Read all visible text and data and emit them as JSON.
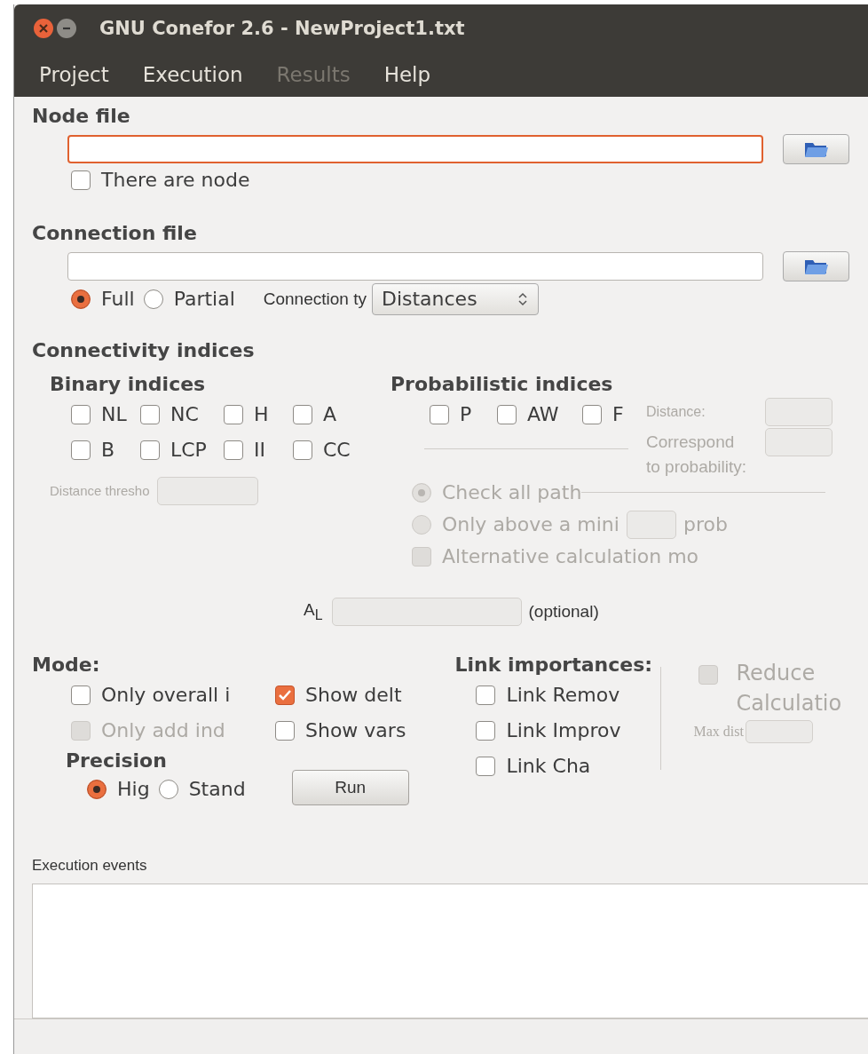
{
  "window": {
    "title": "GNU Conefor 2.6 - NewProject1.txt"
  },
  "menu": [
    {
      "label": "Project",
      "disabled": false
    },
    {
      "label": "Execution",
      "disabled": false
    },
    {
      "label": "Results",
      "disabled": true
    },
    {
      "label": "Help",
      "disabled": false
    }
  ],
  "node_file": {
    "heading": "Node file",
    "focused": true,
    "checkbox": {
      "label": "There are node",
      "checked": false
    }
  },
  "connection_file": {
    "heading": "Connection file",
    "focused": false,
    "options": [
      {
        "label": "Full",
        "selected": true
      },
      {
        "label": "Partial",
        "selected": false
      }
    ],
    "type_label": "Connection ty",
    "type_value": "Distances"
  },
  "connectivity": {
    "heading": "Connectivity indices",
    "binary": {
      "heading": "Binary indices",
      "items": [
        {
          "label": "NL",
          "checked": false
        },
        {
          "label": "NC",
          "checked": false
        },
        {
          "label": "H",
          "checked": false
        },
        {
          "label": "A",
          "checked": false
        },
        {
          "label": "B",
          "checked": false
        },
        {
          "label": "LCP",
          "checked": false
        },
        {
          "label": "II",
          "checked": false
        },
        {
          "label": "CC",
          "checked": false
        }
      ],
      "threshold_label": "Distance thresho"
    },
    "probabilistic": {
      "heading": "Probabilistic indices",
      "items": [
        {
          "label": "P",
          "checked": false
        },
        {
          "label": "AW",
          "checked": false
        },
        {
          "label": "F",
          "checked": false
        }
      ],
      "distance_label": "Distance:",
      "correspond_label": "Correspond",
      "probability_label": "to probability:",
      "paths": [
        {
          "label": "Check all path",
          "selected": true,
          "disabled": true
        },
        {
          "label": "Only above a mini",
          "selected": false,
          "disabled": true,
          "suffix": "prob"
        }
      ],
      "alternative": {
        "label": "Alternative calculation mo",
        "checked": false,
        "disabled": true
      }
    },
    "al": {
      "label": "A$_{L}$",
      "note": "(optional)"
    }
  },
  "mode": {
    "heading": "Mode:",
    "items": [
      {
        "label": "Only overall i",
        "checked": false,
        "disabled": false
      },
      {
        "label": "Show delt",
        "checked": true,
        "disabled": false
      },
      {
        "label": "Only add ind",
        "checked": false,
        "disabled": true
      },
      {
        "label": "Show vars",
        "checked": false,
        "disabled": false
      }
    ]
  },
  "precision": {
    "heading": "Precision",
    "options": [
      {
        "label": "Hig",
        "selected": true
      },
      {
        "label": "Stand",
        "selected": false
      }
    ],
    "run": "Run"
  },
  "link_importances": {
    "heading": "Link importances:",
    "items": [
      {
        "label": "Link Remov",
        "checked": false
      },
      {
        "label": "Link Improv",
        "checked": false
      },
      {
        "label": "Link Cha",
        "checked": false
      }
    ]
  },
  "reduce": {
    "line1": "Reduce",
    "line2": "Calculatio",
    "checked": false,
    "disabled": true,
    "max_dist_label": "Max dist"
  },
  "events": {
    "label": "Execution events"
  }
}
